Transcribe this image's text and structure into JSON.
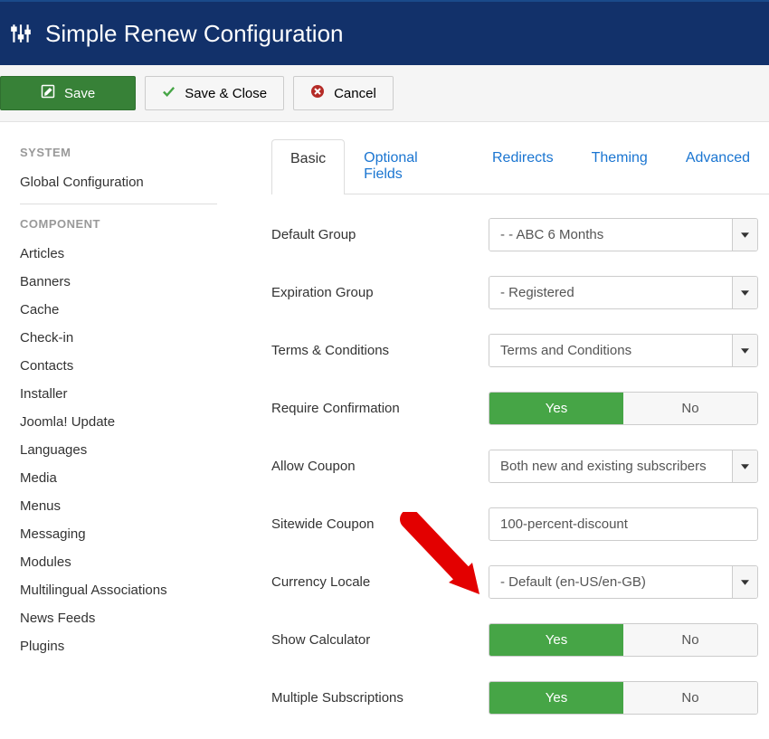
{
  "header": {
    "title": "Simple Renew Configuration"
  },
  "toolbar": {
    "save": "Save",
    "saveClose": "Save & Close",
    "cancel": "Cancel"
  },
  "sidebar": {
    "systemHeading": "SYSTEM",
    "systemItems": [
      "Global Configuration"
    ],
    "componentHeading": "COMPONENT",
    "componentItems": [
      "Articles",
      "Banners",
      "Cache",
      "Check-in",
      "Contacts",
      "Installer",
      "Joomla! Update",
      "Languages",
      "Media",
      "Menus",
      "Messaging",
      "Modules",
      "Multilingual Associations",
      "News Feeds",
      "Plugins"
    ]
  },
  "tabs": [
    "Basic",
    "Optional Fields",
    "Redirects",
    "Theming",
    "Advanced"
  ],
  "activeTab": 0,
  "fields": {
    "defaultGroup": {
      "label": "Default Group",
      "type": "select",
      "value": "- - ABC 6 Months"
    },
    "expirationGroup": {
      "label": "Expiration Group",
      "type": "select",
      "value": "- Registered"
    },
    "termsConditions": {
      "label": "Terms & Conditions",
      "type": "select",
      "value": "Terms and Conditions"
    },
    "requireConfirmation": {
      "label": "Require Confirmation",
      "type": "toggle",
      "yes": "Yes",
      "no": "No",
      "value": "yes"
    },
    "allowCoupon": {
      "label": "Allow Coupon",
      "type": "select",
      "value": "Both new and existing subscribers"
    },
    "sitewideCoupon": {
      "label": "Sitewide Coupon",
      "type": "text",
      "value": "100-percent-discount"
    },
    "currencyLocale": {
      "label": "Currency Locale",
      "type": "select",
      "value": "- Default (en-US/en-GB)"
    },
    "showCalculator": {
      "label": "Show Calculator",
      "type": "toggle",
      "yes": "Yes",
      "no": "No",
      "value": "yes"
    },
    "multipleSubs": {
      "label": "Multiple Subscriptions",
      "type": "toggle",
      "yes": "Yes",
      "no": "No",
      "value": "yes"
    }
  }
}
